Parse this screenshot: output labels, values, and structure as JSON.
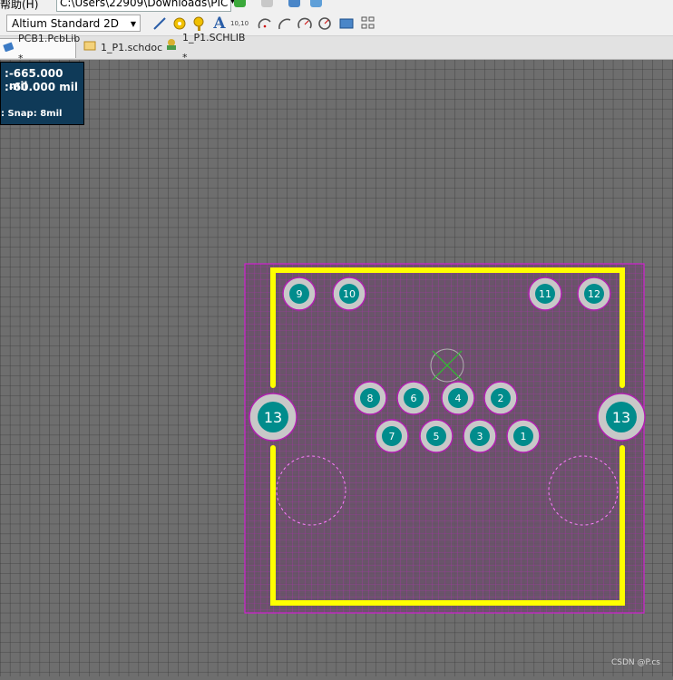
{
  "menubar": {
    "menu_label": "帮助(H)",
    "path_value": "C:\\Users\\22909\\Downloads\\PIC"
  },
  "toolbar": {
    "view_mode": "Altium Standard 2D",
    "coord_badge": "10,10"
  },
  "tabs": [
    {
      "label": "PCB1.PcbLib *",
      "icon": "pcb-icon",
      "active": true
    },
    {
      "label": "1_P1.schdoc",
      "icon": "schematic-icon",
      "active": false
    },
    {
      "label": "1_P1.SCHLIB *",
      "icon": "schlib-icon",
      "active": false
    }
  ],
  "hud": {
    "x_value": "-665.000 mil",
    "y_value": "-60.000 mil",
    "snap": ": Snap: 8mil",
    "x_label": ":",
    "y_label": ":"
  },
  "pads": [
    "9",
    "10",
    "11",
    "12",
    "8",
    "6",
    "4",
    "2",
    "7",
    "5",
    "3",
    "1",
    "13",
    "13"
  ],
  "watermark": "CSDN @P.cs",
  "colors": {
    "grid_bg": "#6e6e6e",
    "silkscreen": "#ffff00",
    "courtyard": "#c000c0",
    "pad_ring": "#c8c8c8",
    "pad_core": "#008c8c"
  }
}
